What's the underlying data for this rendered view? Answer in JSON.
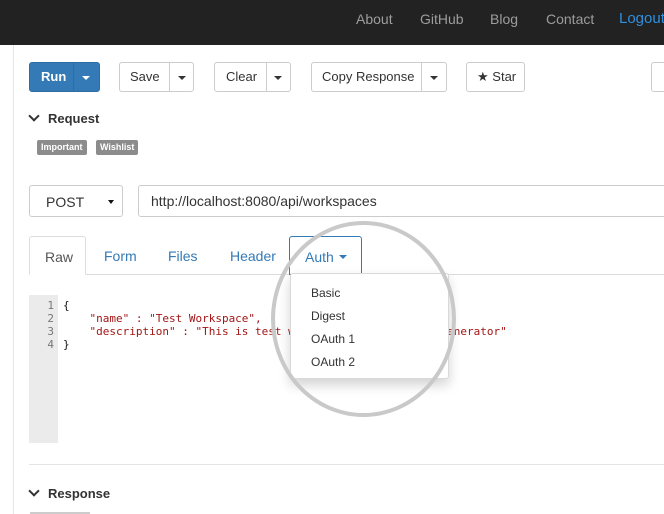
{
  "nav": {
    "about": "About",
    "github": "GitHub",
    "blog": "Blog",
    "contact": "Contact",
    "logout": "Logout"
  },
  "toolbar": {
    "run": "Run",
    "save": "Save",
    "clear": "Clear",
    "copy_response": "Copy Response",
    "star_icon": "★",
    "star": "Star"
  },
  "request": {
    "heading": "Request",
    "tags": [
      "Important",
      "Wishlist"
    ],
    "method": "POST",
    "url": "http://localhost:8080/api/workspaces"
  },
  "tabs": {
    "raw": "Raw",
    "form": "Form",
    "files": "Files",
    "header": "Header",
    "auth": "Auth"
  },
  "auth_menu": [
    "Basic",
    "Digest",
    "OAuth 1",
    "OAuth 2"
  ],
  "editor": {
    "line_numbers": [
      "1",
      "2",
      "3",
      "4"
    ],
    "lines": [
      "{",
      "    \"name\" : \"Test Workspace\",",
      "    \"description\" : \"This is test workspace for the data generator\"",
      "}"
    ]
  },
  "response": {
    "heading": "Response"
  },
  "colors": {
    "navbar": "#222222",
    "primary": "#337ab7",
    "link": "#337ab7",
    "tag": "#8c8c8c"
  },
  "icons": [
    "chevron-down-icon",
    "caret-down-icon",
    "star-icon"
  ]
}
